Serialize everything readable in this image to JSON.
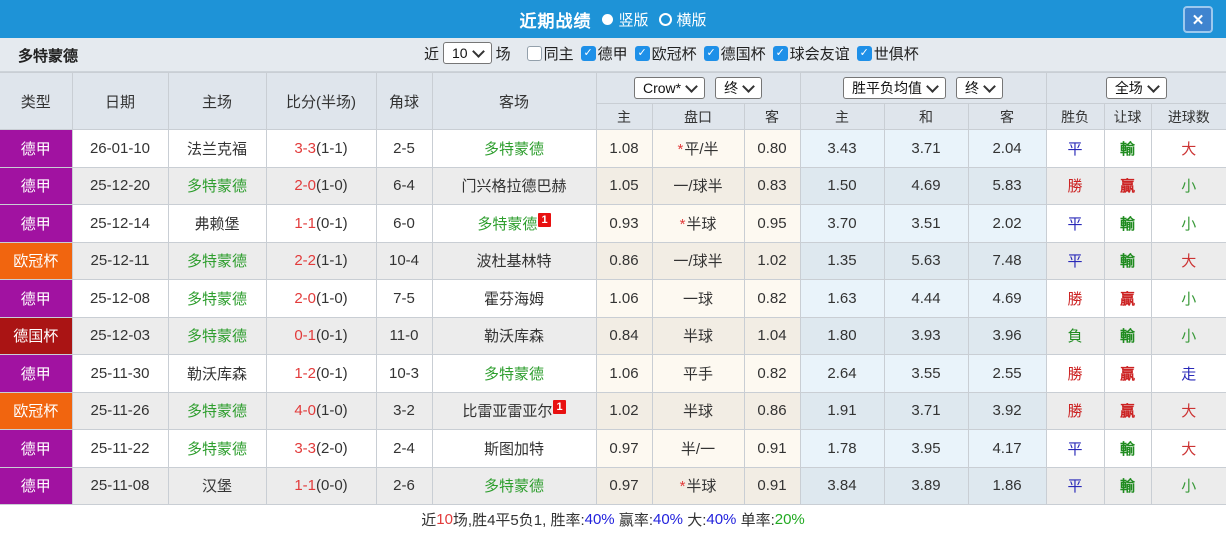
{
  "colors": {
    "topbar": "#1e93d7",
    "type_badges": {
      "德甲": "#a112a1",
      "欧冠杯": "#f1650f",
      "德国杯": "#aa1414"
    },
    "team_highlight": "#2e9e2e",
    "score": "#e23b3b",
    "checkbox": "#1e90e8",
    "win": "#cc2222",
    "draw": "#2929b8",
    "lose": "#1f8b1f",
    "big": "#cc3333",
    "small": "#3a9a3a",
    "walk": "#2929b8"
  },
  "titlebar": {
    "title": "近期战绩",
    "radios": [
      {
        "label": "竖版",
        "selected": true
      },
      {
        "label": "横版",
        "selected": false
      }
    ],
    "close_label": "✕"
  },
  "filterbar": {
    "team": "多特蒙德",
    "recent_prefix": "近",
    "recent_value": "10",
    "recent_suffix": "场",
    "checkboxes": [
      {
        "label": "同主",
        "checked": false
      },
      {
        "label": "德甲",
        "checked": true
      },
      {
        "label": "欧冠杯",
        "checked": true
      },
      {
        "label": "德国杯",
        "checked": true
      },
      {
        "label": "球会友谊",
        "checked": true
      },
      {
        "label": "世俱杯",
        "checked": true
      }
    ]
  },
  "table": {
    "left_headers": [
      "类型",
      "日期",
      "主场",
      "比分(半场)",
      "角球",
      "客场"
    ],
    "dropdowns": {
      "odds_source": "Crow*",
      "odds_stage": "终",
      "avg_label": "胜平负均值",
      "avg_stage": "终",
      "result_scope": "全场"
    },
    "sub_headers": [
      "主",
      "盘口",
      "客",
      "主",
      "和",
      "客",
      "胜负",
      "让球",
      "进球数"
    ],
    "rows": [
      {
        "type": "德甲",
        "date": "26-01-10",
        "home": "法兰克福",
        "home_hl": false,
        "score": "3-3",
        "half": "(1-1)",
        "corner": "2-5",
        "away": "多特蒙德",
        "away_hl": true,
        "away_badge": "",
        "odds_home": "1.08",
        "handicap_star": true,
        "handicap": "平/半",
        "odds_away": "0.80",
        "avg_home": "3.43",
        "avg_draw": "3.71",
        "avg_away": "2.04",
        "result": "平",
        "result_k": "draw",
        "let": "輸",
        "let_k": "lose",
        "goals": "大",
        "goals_k": "big"
      },
      {
        "type": "德甲",
        "date": "25-12-20",
        "home": "多特蒙德",
        "home_hl": true,
        "score": "2-0",
        "half": "(1-0)",
        "corner": "6-4",
        "away": "门兴格拉德巴赫",
        "away_hl": false,
        "away_badge": "",
        "odds_home": "1.05",
        "handicap_star": false,
        "handicap": "一/球半",
        "odds_away": "0.83",
        "avg_home": "1.50",
        "avg_draw": "4.69",
        "avg_away": "5.83",
        "result": "勝",
        "result_k": "win",
        "let": "贏",
        "let_k": "win",
        "goals": "小",
        "goals_k": "small"
      },
      {
        "type": "德甲",
        "date": "25-12-14",
        "home": "弗赖堡",
        "home_hl": false,
        "score": "1-1",
        "half": "(0-1)",
        "corner": "6-0",
        "away": "多特蒙德",
        "away_hl": true,
        "away_badge": "1",
        "odds_home": "0.93",
        "handicap_star": true,
        "handicap": "半球",
        "odds_away": "0.95",
        "avg_home": "3.70",
        "avg_draw": "3.51",
        "avg_away": "2.02",
        "result": "平",
        "result_k": "draw",
        "let": "輸",
        "let_k": "lose",
        "goals": "小",
        "goals_k": "small"
      },
      {
        "type": "欧冠杯",
        "date": "25-12-11",
        "home": "多特蒙德",
        "home_hl": true,
        "score": "2-2",
        "half": "(1-1)",
        "corner": "10-4",
        "away": "波杜基林特",
        "away_hl": false,
        "away_badge": "",
        "odds_home": "0.86",
        "handicap_star": false,
        "handicap": "一/球半",
        "odds_away": "1.02",
        "avg_home": "1.35",
        "avg_draw": "5.63",
        "avg_away": "7.48",
        "result": "平",
        "result_k": "draw",
        "let": "輸",
        "let_k": "lose",
        "goals": "大",
        "goals_k": "big"
      },
      {
        "type": "德甲",
        "date": "25-12-08",
        "home": "多特蒙德",
        "home_hl": true,
        "score": "2-0",
        "half": "(1-0)",
        "corner": "7-5",
        "away": "霍芬海姆",
        "away_hl": false,
        "away_badge": "",
        "odds_home": "1.06",
        "handicap_star": false,
        "handicap": "一球",
        "odds_away": "0.82",
        "avg_home": "1.63",
        "avg_draw": "4.44",
        "avg_away": "4.69",
        "result": "勝",
        "result_k": "win",
        "let": "贏",
        "let_k": "win",
        "goals": "小",
        "goals_k": "small"
      },
      {
        "type": "德国杯",
        "date": "25-12-03",
        "home": "多特蒙德",
        "home_hl": true,
        "score": "0-1",
        "half": "(0-1)",
        "corner": "11-0",
        "away": "勒沃库森",
        "away_hl": false,
        "away_badge": "",
        "odds_home": "0.84",
        "handicap_star": false,
        "handicap": "半球",
        "odds_away": "1.04",
        "avg_home": "1.80",
        "avg_draw": "3.93",
        "avg_away": "3.96",
        "result": "負",
        "result_k": "lose",
        "let": "輸",
        "let_k": "lose",
        "goals": "小",
        "goals_k": "small"
      },
      {
        "type": "德甲",
        "date": "25-11-30",
        "home": "勒沃库森",
        "home_hl": false,
        "score": "1-2",
        "half": "(0-1)",
        "corner": "10-3",
        "away": "多特蒙德",
        "away_hl": true,
        "away_badge": "",
        "odds_home": "1.06",
        "handicap_star": false,
        "handicap": "平手",
        "odds_away": "0.82",
        "avg_home": "2.64",
        "avg_draw": "3.55",
        "avg_away": "2.55",
        "result": "勝",
        "result_k": "win",
        "let": "贏",
        "let_k": "win",
        "goals": "走",
        "goals_k": "walk"
      },
      {
        "type": "欧冠杯",
        "date": "25-11-26",
        "home": "多特蒙德",
        "home_hl": true,
        "score": "4-0",
        "half": "(1-0)",
        "corner": "3-2",
        "away": "比雷亚雷亚尔",
        "away_hl": false,
        "away_badge": "1",
        "odds_home": "1.02",
        "handicap_star": false,
        "handicap": "半球",
        "odds_away": "0.86",
        "avg_home": "1.91",
        "avg_draw": "3.71",
        "avg_away": "3.92",
        "result": "勝",
        "result_k": "win",
        "let": "贏",
        "let_k": "win",
        "goals": "大",
        "goals_k": "big"
      },
      {
        "type": "德甲",
        "date": "25-11-22",
        "home": "多特蒙德",
        "home_hl": true,
        "score": "3-3",
        "half": "(2-0)",
        "corner": "2-4",
        "away": "斯图加特",
        "away_hl": false,
        "away_badge": "",
        "odds_home": "0.97",
        "handicap_star": false,
        "handicap": "半/一",
        "odds_away": "0.91",
        "avg_home": "1.78",
        "avg_draw": "3.95",
        "avg_away": "4.17",
        "result": "平",
        "result_k": "draw",
        "let": "輸",
        "let_k": "lose",
        "goals": "大",
        "goals_k": "big"
      },
      {
        "type": "德甲",
        "date": "25-11-08",
        "home": "汉堡",
        "home_hl": false,
        "score": "1-1",
        "half": "(0-0)",
        "corner": "2-6",
        "away": "多特蒙德",
        "away_hl": true,
        "away_badge": "",
        "odds_home": "0.97",
        "handicap_star": true,
        "handicap": "半球",
        "odds_away": "0.91",
        "avg_home": "3.84",
        "avg_draw": "3.89",
        "avg_away": "1.86",
        "result": "平",
        "result_k": "draw",
        "let": "輸",
        "let_k": "lose",
        "goals": "小",
        "goals_k": "small"
      }
    ]
  },
  "footer": {
    "segments": [
      {
        "text": "近",
        "color": "#333333"
      },
      {
        "text": "10",
        "color": "#e23b3b"
      },
      {
        "text": "场,胜4平5负1, 胜率:",
        "color": "#333333"
      },
      {
        "text": "40%",
        "color": "#2222dd"
      },
      {
        "text": " 赢率:",
        "color": "#333333"
      },
      {
        "text": "40%",
        "color": "#2222dd"
      },
      {
        "text": " 大:",
        "color": "#333333"
      },
      {
        "text": "40%",
        "color": "#2222dd"
      },
      {
        "text": " 单率:",
        "color": "#333333"
      },
      {
        "text": "20%",
        "color": "#22aa22"
      }
    ]
  }
}
